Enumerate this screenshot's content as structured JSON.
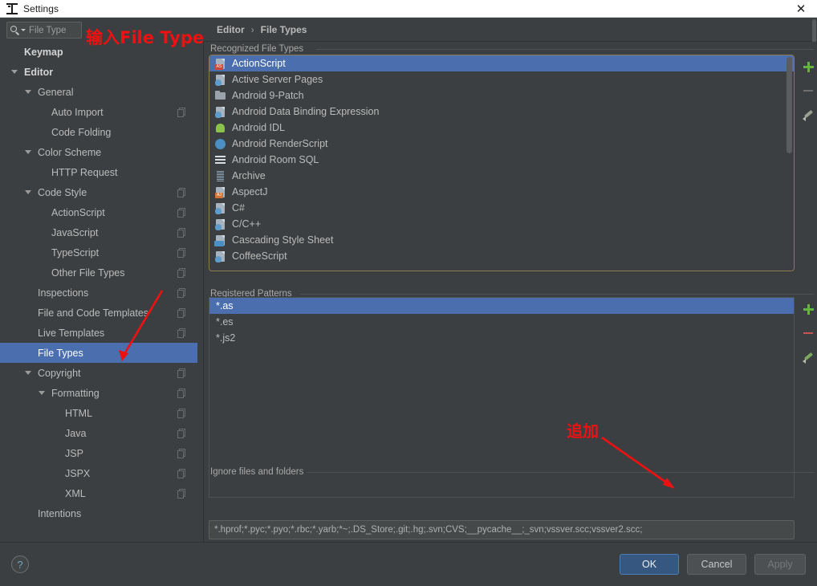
{
  "window": {
    "title": "Settings",
    "app_icon": "intellij-idea-icon",
    "close_label": "✕"
  },
  "search": {
    "value": "File Type",
    "icon": "search-icon"
  },
  "breadcrumb": {
    "parent": "Editor",
    "separator": "›",
    "current": "File Types"
  },
  "sidebar": {
    "items": [
      {
        "label": "Keymap",
        "indent": 0,
        "bold": true,
        "twisty": false,
        "copy": false,
        "selected": false
      },
      {
        "label": "Editor",
        "indent": 0,
        "bold": true,
        "twisty": true,
        "copy": false,
        "selected": false
      },
      {
        "label": "General",
        "indent": 1,
        "bold": false,
        "twisty": true,
        "copy": false,
        "selected": false
      },
      {
        "label": "Auto Import",
        "indent": 2,
        "bold": false,
        "twisty": false,
        "copy": true,
        "selected": false
      },
      {
        "label": "Code Folding",
        "indent": 2,
        "bold": false,
        "twisty": false,
        "copy": false,
        "selected": false
      },
      {
        "label": "Color Scheme",
        "indent": 1,
        "bold": false,
        "twisty": true,
        "copy": false,
        "selected": false
      },
      {
        "label": "HTTP Request",
        "indent": 2,
        "bold": false,
        "twisty": false,
        "copy": false,
        "selected": false
      },
      {
        "label": "Code Style",
        "indent": 1,
        "bold": false,
        "twisty": true,
        "copy": true,
        "selected": false
      },
      {
        "label": "ActionScript",
        "indent": 2,
        "bold": false,
        "twisty": false,
        "copy": true,
        "selected": false
      },
      {
        "label": "JavaScript",
        "indent": 2,
        "bold": false,
        "twisty": false,
        "copy": true,
        "selected": false
      },
      {
        "label": "TypeScript",
        "indent": 2,
        "bold": false,
        "twisty": false,
        "copy": true,
        "selected": false
      },
      {
        "label": "Other File Types",
        "indent": 2,
        "bold": false,
        "twisty": false,
        "copy": true,
        "selected": false
      },
      {
        "label": "Inspections",
        "indent": 1,
        "bold": false,
        "twisty": false,
        "copy": true,
        "selected": false
      },
      {
        "label": "File and Code Templates",
        "indent": 1,
        "bold": false,
        "twisty": false,
        "copy": true,
        "selected": false
      },
      {
        "label": "Live Templates",
        "indent": 1,
        "bold": false,
        "twisty": false,
        "copy": true,
        "selected": false
      },
      {
        "label": "File Types",
        "indent": 1,
        "bold": false,
        "twisty": false,
        "copy": false,
        "selected": true
      },
      {
        "label": "Copyright",
        "indent": 1,
        "bold": false,
        "twisty": true,
        "copy": true,
        "selected": false
      },
      {
        "label": "Formatting",
        "indent": 2,
        "bold": false,
        "twisty": true,
        "copy": true,
        "selected": false
      },
      {
        "label": "HTML",
        "indent": 3,
        "bold": false,
        "twisty": false,
        "copy": true,
        "selected": false
      },
      {
        "label": "Java",
        "indent": 3,
        "bold": false,
        "twisty": false,
        "copy": true,
        "selected": false
      },
      {
        "label": "JSP",
        "indent": 3,
        "bold": false,
        "twisty": false,
        "copy": true,
        "selected": false
      },
      {
        "label": "JSPX",
        "indent": 3,
        "bold": false,
        "twisty": false,
        "copy": true,
        "selected": false
      },
      {
        "label": "XML",
        "indent": 3,
        "bold": false,
        "twisty": false,
        "copy": true,
        "selected": false
      },
      {
        "label": "Intentions",
        "indent": 1,
        "bold": false,
        "twisty": false,
        "copy": false,
        "selected": false
      }
    ]
  },
  "main": {
    "recognized_label": "Recognized File Types",
    "patterns_label": "Registered Patterns",
    "ignore_label": "Ignore files and folders",
    "ignore_value": "*.hprof;*.pyc;*.pyo;*.rbc;*.yarb;*~;.DS_Store;.git;.hg;.svn;CVS;__pycache__;_svn;vssver.scc;vssver2.scc;",
    "file_types": [
      {
        "label": "ActionScript",
        "icon": "actionscript-file-icon",
        "selected": true
      },
      {
        "label": "Active Server Pages",
        "icon": "asp-file-icon",
        "selected": false
      },
      {
        "label": "Android 9-Patch",
        "icon": "folder-icon",
        "selected": false
      },
      {
        "label": "Android Data Binding Expression",
        "icon": "android-databinding-icon",
        "selected": false
      },
      {
        "label": "Android IDL",
        "icon": "android-robot-icon",
        "selected": false
      },
      {
        "label": "Android RenderScript",
        "icon": "android-renderscript-icon",
        "selected": false
      },
      {
        "label": "Android Room SQL",
        "icon": "sql-lines-icon",
        "selected": false
      },
      {
        "label": "Archive",
        "icon": "archive-icon",
        "selected": false
      },
      {
        "label": "AspectJ",
        "icon": "aspectj-file-icon",
        "selected": false
      },
      {
        "label": "C#",
        "icon": "csharp-file-icon",
        "selected": false
      },
      {
        "label": "C/C++",
        "icon": "cpp-file-icon",
        "selected": false
      },
      {
        "label": "Cascading Style Sheet",
        "icon": "css-file-icon",
        "selected": false
      },
      {
        "label": "CoffeeScript",
        "icon": "coffeescript-file-icon",
        "selected": false
      }
    ],
    "patterns": [
      {
        "label": "*.as",
        "selected": true
      },
      {
        "label": "*.es",
        "selected": false
      },
      {
        "label": "*.js2",
        "selected": false
      }
    ],
    "types_toolbar": [
      {
        "icon": "add-icon",
        "name": "add-file-type-button"
      },
      {
        "icon": "remove-icon",
        "name": "remove-file-type-button"
      },
      {
        "icon": "edit-pencil-icon",
        "name": "edit-file-type-button"
      }
    ],
    "patterns_toolbar": [
      {
        "icon": "add-icon",
        "name": "add-pattern-button"
      },
      {
        "icon": "remove-icon",
        "name": "remove-pattern-button"
      },
      {
        "icon": "edit-pencil-icon",
        "name": "edit-pattern-button"
      }
    ]
  },
  "footer": {
    "help": "?",
    "ok": "OK",
    "cancel": "Cancel",
    "apply": "Apply"
  },
  "annotations": [
    {
      "text": "输入File Type",
      "name": "annotation-input-file-type"
    },
    {
      "text": "追加",
      "name": "annotation-add"
    }
  ],
  "colors": {
    "selection": "#4b6eaf",
    "panel_highlight_border": "#8c7b4f",
    "annotation": "#ee1111",
    "ok_button": "#365880",
    "background": "#3c3f41"
  }
}
